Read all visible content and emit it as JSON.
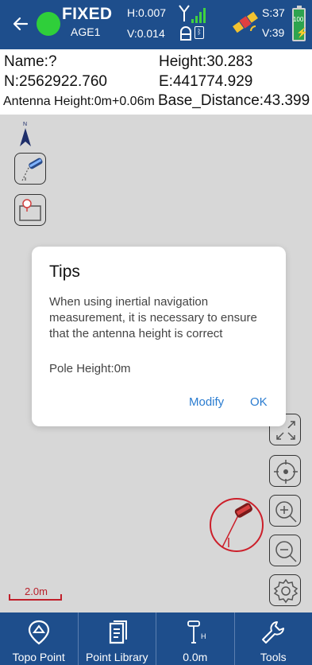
{
  "status": {
    "fix_label": "FIXED",
    "age_label": "AGE1",
    "h_precision": "H:0.007",
    "v_precision": "V:0.014",
    "bt_glyph": "ᛒ",
    "satellites_used": "S:37",
    "satellites_visible": "V:39",
    "battery_label": "100",
    "fix_color": "#2fcf3a",
    "bar_color": "#1e4e8c"
  },
  "info": {
    "name": "Name:?",
    "height": "Height:30.283",
    "northing": "N:2562922.760",
    "easting": "E:441774.929",
    "antenna_height": "Antenna Height:0m+0.06m",
    "base_distance": "Base_Distance:43.399"
  },
  "map": {
    "scale_label": "2.0m"
  },
  "dialog": {
    "title": "Tips",
    "message": "When using inertial navigation measurement, it is necessary to ensure that the antenna height is correct",
    "pole_height": "Pole Height:0m",
    "modify_label": "Modify",
    "ok_label": "OK"
  },
  "nav": [
    {
      "label": "Topo Point",
      "icon": "map-pin-icon"
    },
    {
      "label": "Point Library",
      "icon": "document-icon"
    },
    {
      "label": "0.0m",
      "icon": "antenna-height-icon"
    },
    {
      "label": "Tools",
      "icon": "wrench-icon"
    }
  ]
}
